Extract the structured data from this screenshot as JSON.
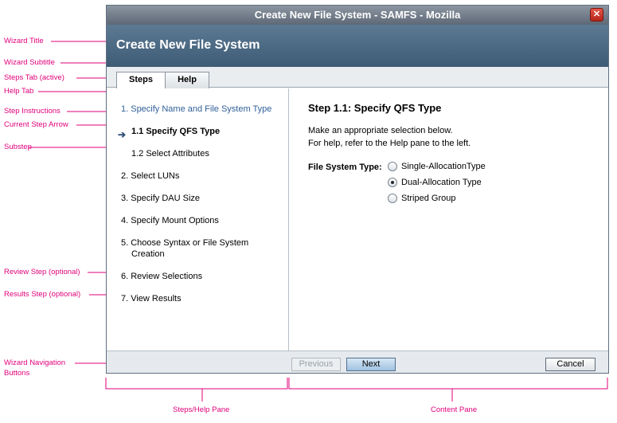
{
  "window": {
    "title": "Create New File System - SAMFS - Mozilla",
    "close_glyph": "✕"
  },
  "wizard": {
    "title": "Create New File System"
  },
  "tabs": [
    {
      "label": "Steps",
      "active": true
    },
    {
      "label": "Help",
      "active": false
    }
  ],
  "steps": [
    {
      "label": "1. Specify Name and File System Type",
      "state": "link"
    },
    {
      "label": "1.1 Specify QFS Type",
      "state": "current"
    },
    {
      "label": "1.2 Select Attributes",
      "state": "substep"
    },
    {
      "label": "2. Select LUNs",
      "state": "normal"
    },
    {
      "label": "3. Specify DAU Size",
      "state": "normal"
    },
    {
      "label": "4. Specify Mount Options",
      "state": "normal"
    },
    {
      "label": "5. Choose Syntax or File System",
      "state": "normal"
    },
    {
      "label": "Creation",
      "state": "normal"
    },
    {
      "label": "6. Review Selections",
      "state": "normal"
    },
    {
      "label": "7. View Results",
      "state": "normal"
    }
  ],
  "current_arrow": "➔",
  "content": {
    "step_title": "Step 1.1:  Specify QFS Type",
    "instructions_line1": "Make an appropriate selection below.",
    "instructions_line2": "For help, refer to the Help pane to the left.",
    "fs_type_label": "File System Type:",
    "options": [
      {
        "label": "Single-AllocationType",
        "selected": false
      },
      {
        "label": "Dual-Allocation Type",
        "selected": true
      },
      {
        "label": "Striped Group",
        "selected": false
      }
    ]
  },
  "buttons": {
    "previous": "Previous",
    "next": "Next",
    "cancel": "Cancel"
  },
  "annotations": {
    "wizard_title": "Wizard Title",
    "wizard_subtitle": "Wizard Subtitle",
    "steps_tab": "Steps Tab (active)",
    "help_tab": "Help Tab",
    "step_instructions": "Step Instructions",
    "current_step_arrow": "Current Step Arrow",
    "substep": "Substep",
    "review_step": "Review Step (optional)",
    "results_step": "Results Step (optional)",
    "nav_buttons_1": "Wizard Navigation",
    "nav_buttons_2": "Buttons",
    "steps_help_pane": "Steps/Help Pane",
    "content_pane": "Content Pane"
  },
  "colors": {
    "annotation": "#e0007a",
    "header": "#4a6882",
    "link": "#2f5f98"
  }
}
